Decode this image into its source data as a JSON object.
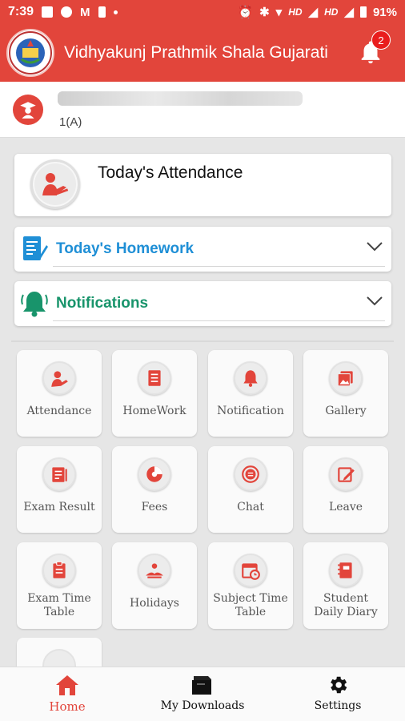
{
  "statusbar": {
    "time": "7:39",
    "network1": "HD",
    "network2": "HD",
    "battery": "91%"
  },
  "appbar": {
    "title": "Vidhyakunj Prathmik Shala Gujarati",
    "notification_count": "2"
  },
  "student": {
    "class": "1(A)"
  },
  "attendance_card": {
    "title": "Today's Attendance"
  },
  "homework": {
    "title": "Today's Homework",
    "color": "#1f8fd6"
  },
  "notifications": {
    "title": "Notifications",
    "color": "#18946b"
  },
  "accent": "#e2453b",
  "tiles": [
    {
      "label": "Attendance",
      "icon": "attendance-icon"
    },
    {
      "label": "HomeWork",
      "icon": "homework-icon"
    },
    {
      "label": "Notification",
      "icon": "notification-icon"
    },
    {
      "label": "Gallery",
      "icon": "gallery-icon"
    },
    {
      "label": "Exam Result",
      "icon": "exam-result-icon"
    },
    {
      "label": "Fees",
      "icon": "fees-icon"
    },
    {
      "label": "Chat",
      "icon": "chat-icon"
    },
    {
      "label": "Leave",
      "icon": "leave-icon"
    },
    {
      "label": "Exam Time Table",
      "icon": "exam-timetable-icon"
    },
    {
      "label": "Holidays",
      "icon": "holidays-icon"
    },
    {
      "label": "Subject Time Table",
      "icon": "subject-timetable-icon"
    },
    {
      "label": "Student Daily Diary",
      "icon": "diary-icon"
    }
  ],
  "bottomnav": {
    "home": "Home",
    "downloads": "My Downloads",
    "settings": "Settings"
  }
}
